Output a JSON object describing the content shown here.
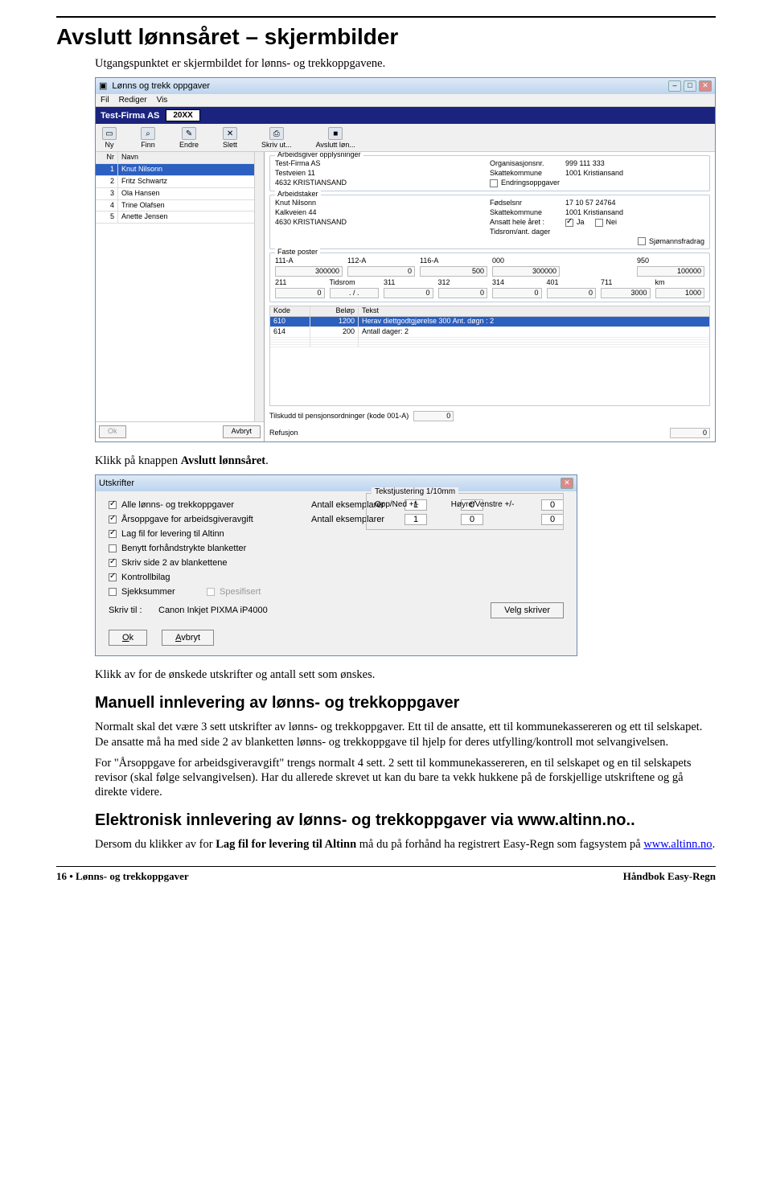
{
  "h1": "Avslutt lønnsåret – skjermbilder",
  "intro": "Utgangspunktet er skjermbildet for lønns- og trekkoppgavene.",
  "after_ss1_pre": "Klikk på knappen ",
  "after_ss1_bold": "Avslutt lønnsåret",
  "after_ss1_post": ".",
  "after_ss2": "Klikk av for de ønskede utskrifter og antall sett som ønskes.",
  "h2a": "Manuell innlevering av lønns- og trekkoppgaver",
  "p1": "Normalt skal det være 3 sett utskrifter av lønns- og trekkoppgaver. Ett til de ansatte, ett til kommunekassereren og ett til selskapet. De ansatte må ha med side 2 av blanketten lønns- og trekkoppgave til hjelp for deres utfylling/kontroll mot selvangivelsen.",
  "p2": "For \"Årsoppgave for arbeidsgiveravgift\" trengs normalt 4 sett. 2 sett til kommunekassereren, en til selskapet og en til selskapets revisor (skal følge selvangivelsen). Har du allerede skrevet ut kan du bare ta vekk hukkene på de forskjellige utskriftene og gå direkte videre.",
  "h2b": "Elektronisk innlevering av lønns- og trekkoppgaver via www.altinn.no..",
  "p3_pre": "Dersom du klikker av for ",
  "p3_bold": "Lag fil for levering til Altinn",
  "p3_post": " må du på forhånd ha registrert Easy-Regn som fagsystem på ",
  "p3_link": "www.altinn.no",
  "p3_end": ".",
  "footer_left": "16 • Lønns- og trekkoppgaver",
  "footer_right": "Håndbok Easy-Regn",
  "ss1": {
    "title": "Lønns og trekk oppgaver",
    "menu": [
      "Fil",
      "Rediger",
      "Vis"
    ],
    "company": "Test-Firma AS",
    "year": "20XX",
    "tools": {
      "ny": "Ny",
      "finn": "Finn",
      "endre": "Endre",
      "slett": "Slett",
      "skriv": "Skriv ut...",
      "avslutt": "Avslutt løn..."
    },
    "list_head": {
      "nr": "Nr",
      "navn": "Navn"
    },
    "list": [
      {
        "nr": "1",
        "navn": "Knut Nilsonn"
      },
      {
        "nr": "2",
        "navn": "Fritz Schwartz"
      },
      {
        "nr": "3",
        "navn": "Ola Hansen"
      },
      {
        "nr": "4",
        "navn": "Trine Olafsen"
      },
      {
        "nr": "5",
        "navn": "Anette Jensen"
      }
    ],
    "ok": "Ok",
    "avbryt": "Avbryt",
    "grp_arbgiver": {
      "legend": "Arbeidsgiver opplysninger",
      "name": "Test-Firma AS",
      "addr": "Testveien 11",
      "post": "4632   KRISTIANSAND",
      "orgnr_l": "Organisasjonsnr.",
      "orgnr": "999 111 333",
      "skk_l": "Skattekommune",
      "skk": "1001   Kristiansand",
      "endr": "Endringsoppgaver"
    },
    "grp_arbtaker": {
      "legend": "Arbeidstaker",
      "name": "Knut Nilsonn",
      "addr": "Kalkveien 44",
      "post": "4630   KRISTIANSAND",
      "fod_l": "Fødselsnr",
      "fod": "17 10 57 24764",
      "skk_l": "Skattekommune",
      "skk": "1001   Kristiansand",
      "ans_l": "Ansatt hele året :",
      "ja": "Ja",
      "nei": "Nei",
      "tid_l": "Tidsrom/ant. dager",
      "sjo": "Sjømannsfradrag"
    },
    "grp_faste": {
      "legend": "Faste poster",
      "row1_codes": [
        "111-A",
        "112-A",
        "116-A",
        "000",
        "",
        "950"
      ],
      "row1_vals": [
        "300000",
        "0",
        "500",
        "300000",
        "",
        "100000"
      ],
      "row2_codes": [
        "211",
        "Tidsrom",
        "311",
        "312",
        "314",
        "401",
        "711",
        "km"
      ],
      "row2_vals": [
        "0",
        ". / .",
        "0",
        "0",
        "0",
        "0",
        "3000",
        "1000"
      ]
    },
    "table2": {
      "head": {
        "kode": "Kode",
        "belop": "Beløp",
        "tekst": "Tekst"
      },
      "rows": [
        {
          "kode": "610",
          "belop": "1200",
          "tekst": "Herav diettgodtgjørelse    300 Ant. døgn :   2"
        },
        {
          "kode": "614",
          "belop": "200",
          "tekst": "Antall dager:   2"
        }
      ]
    },
    "tilskudd_l": "Tilskudd til pensjonsordninger  (kode 001-A)",
    "tilskudd_v": "0",
    "refusjon_l": "Refusjon",
    "refusjon_v": "0"
  },
  "ss2": {
    "title": "Utskrifter",
    "grp_legend": "Tekstjustering 1/10mm",
    "opp": "Opp/Ned +/-",
    "hoy": "Høyre/Venstre +/-",
    "rows": [
      {
        "on": true,
        "label": "Alle lønns- og trekkoppgaver",
        "mid": "Antall eksemplarer",
        "val": "1",
        "j1": "0",
        "j2": "0"
      },
      {
        "on": true,
        "label": "Årsoppgave for arbeidsgiveravgift",
        "mid": "Antall eksemplarer",
        "val": "1",
        "j1": "0",
        "j2": "0"
      },
      {
        "on": true,
        "label": "Lag fil for levering til Altinn"
      },
      {
        "on": false,
        "label": "Benytt forhåndstrykte blanketter"
      },
      {
        "on": true,
        "label": "Skriv side 2 av blankettene"
      },
      {
        "on": true,
        "label": "Kontrollbilag"
      },
      {
        "on": false,
        "label": "Sjekksummer",
        "extra_disabled": "Spesifisert"
      }
    ],
    "skriv_til_l": "Skriv til :",
    "printer": "Canon Inkjet PIXMA iP4000",
    "velg": "Velg skriver",
    "ok": "Ok",
    "avbryt": "Avbryt"
  }
}
